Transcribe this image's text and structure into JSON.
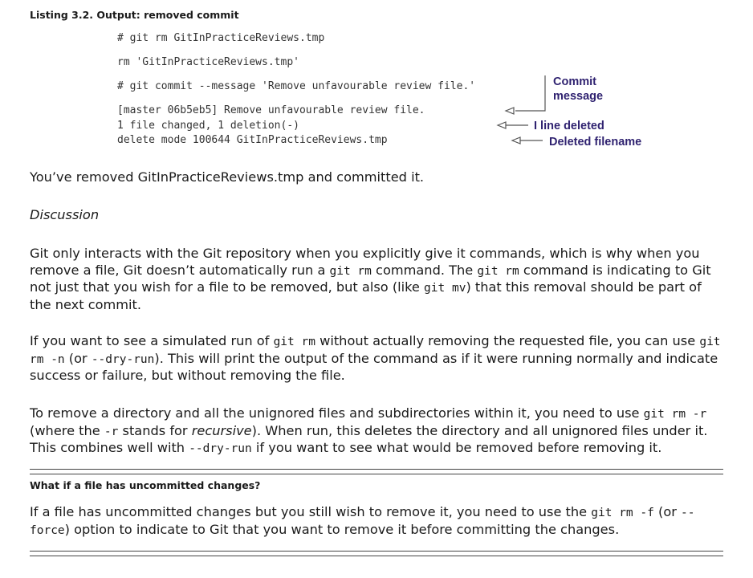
{
  "listing": {
    "title": "Listing 3.2. Output: removed commit",
    "code_lines": [
      "# git rm GitInPracticeReviews.tmp",
      "rm 'GitInPracticeReviews.tmp'",
      "# git commit --message 'Remove unfavourable review file.'",
      "[master 06b5eb5] Remove unfavourable review file.",
      "1 file changed, 1 deletion(-)",
      "delete mode 100644 GitInPracticeReviews.tmp"
    ],
    "annotations": {
      "commit_message_line1": "Commit",
      "commit_message_line2": "message",
      "line_deleted": "I line deleted",
      "deleted_filename": "Deleted filename"
    },
    "colors": {
      "annotation": "#2f2270",
      "code": "#333333"
    }
  },
  "body": {
    "summary": "You’ve removed GitInPracticeReviews.tmp and committed it.",
    "discussion_heading": "Discussion",
    "p1": {
      "t1": "Git only interacts with the Git repository when you explicitly give it commands, which is why when you remove a file, Git doesn’t automatically run a ",
      "c1": "git rm",
      "t2": " command. The ",
      "c2": "git rm",
      "t3": " command is indicating to Git not just that you wish for a file to be removed, but also (like ",
      "c3": "git mv",
      "t4": ") that this removal should be part of the next commit."
    },
    "p2": {
      "t1": "If you want to see a simulated run of ",
      "c1": "git rm",
      "t2": " without actually removing the requested file, you can use ",
      "c2": "git rm -n",
      "t3": " (or ",
      "c3": "--dry-run",
      "t4": "). This will print the output of the command as if it were running normally and indicate success or failure, but without removing the file."
    },
    "p3": {
      "t1": "To remove a directory and all the unignored files and subdirectories within it, you need to use ",
      "c1": "git rm -r",
      "t2": " (where the ",
      "c2": "-r",
      "t3": " stands for ",
      "e1": "recursive",
      "t4": "). When run, this deletes the directory and all unignored files under it. This combines well with ",
      "c3": "--dry-run",
      "t5": " if you want to see what would be removed before removing it."
    }
  },
  "sidebar": {
    "title": "What if a file has uncommitted changes?",
    "p": {
      "t1": "If a file has uncommitted changes but you still wish to remove it, you need to use the ",
      "c1": "git rm -f",
      "t2": " (or ",
      "c2": "--force",
      "t3": ") option to indicate to Git that you want to remove it before committing the changes."
    }
  }
}
